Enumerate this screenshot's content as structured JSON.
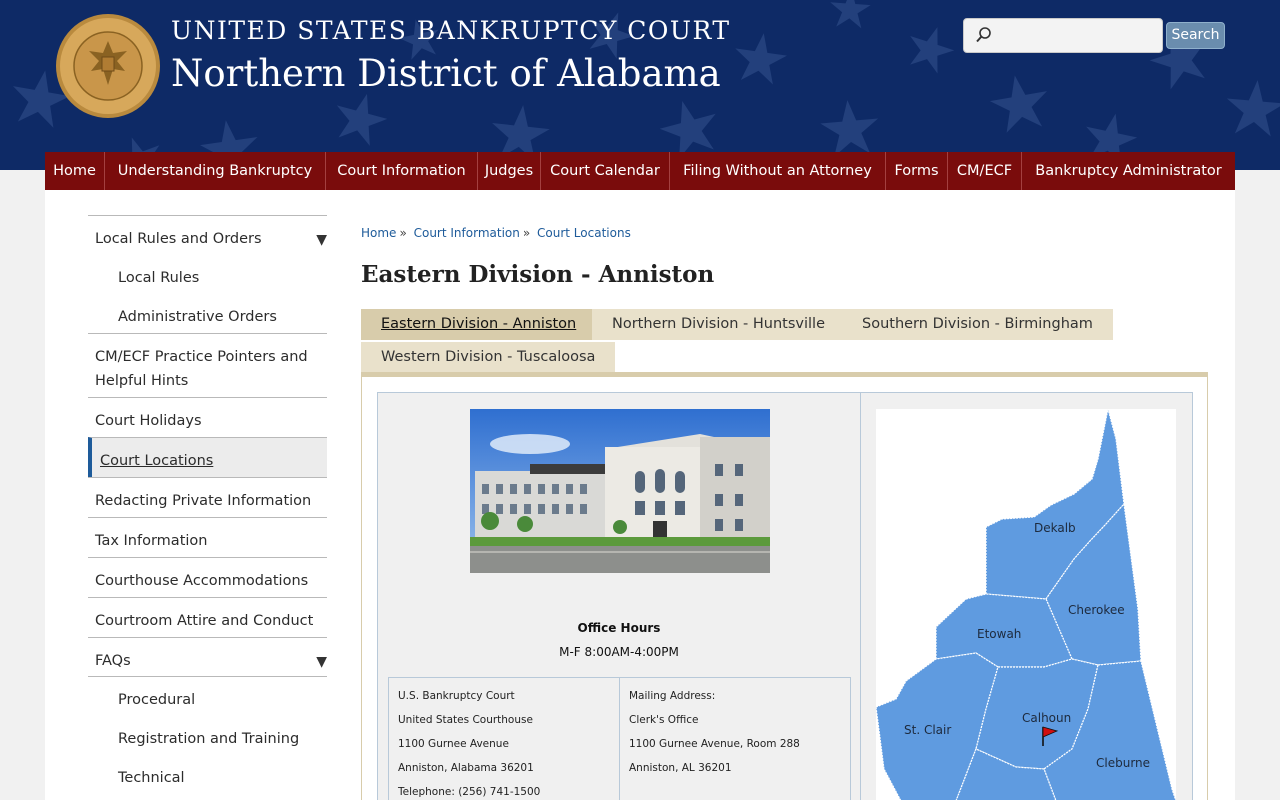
{
  "header": {
    "line1": "UNITED STATES BANKRUPTCY COURT",
    "line2": "Northern District of Alabama",
    "seal_text_top": "UNITED STATES BANKRUPTCY COURT",
    "seal_text_bottom": "NORTHERN DISTRICT OF ALABAMA",
    "search_placeholder": "",
    "search_value": "",
    "search_button": "Search",
    "colors": {
      "header_bg": "#0e2a66",
      "nav_bg": "#7a0c0c",
      "link": "#1e5b9a"
    }
  },
  "nav": [
    "Home",
    "Understanding Bankruptcy",
    "Court Information",
    "Judges",
    "Court Calendar",
    "Filing Without an Attorney",
    "Forms",
    "CM/ECF",
    "Bankruptcy Administrator"
  ],
  "sidebar": [
    {
      "label": "Local Rules and Orders",
      "expandable": true
    },
    {
      "label": "Local Rules",
      "sub": true
    },
    {
      "label": "Administrative Orders",
      "sub": true
    },
    {
      "label": "CM/ECF Practice Pointers and Helpful Hints"
    },
    {
      "label": "Court Holidays"
    },
    {
      "label": "Court Locations",
      "active": true
    },
    {
      "label": "Redacting Private Information"
    },
    {
      "label": "Tax Information"
    },
    {
      "label": "Courthouse Accommodations"
    },
    {
      "label": "Courtroom Attire and Conduct"
    },
    {
      "label": "FAQs",
      "expandable": true
    },
    {
      "label": "Procedural",
      "sub": true
    },
    {
      "label": "Registration and Training",
      "sub": true
    },
    {
      "label": "Technical",
      "sub": true
    }
  ],
  "breadcrumb": {
    "home": "Home",
    "section": "Court Information",
    "page": "Court Locations",
    "separator": "»"
  },
  "page_title": "Eastern Division - Anniston",
  "tabs": [
    "Eastern Division - Anniston",
    "Northern Division - Huntsville",
    "Southern Division - Birmingham",
    "Western Division - Tuscaloosa"
  ],
  "office": {
    "hours_title": "Office Hours",
    "hours": "M-F 8:00AM-4:00PM",
    "physical": [
      "U.S. Bankruptcy Court",
      "United States Courthouse",
      "1100 Gurnee Avenue",
      "Anniston, Alabama 36201",
      "Telephone: (256) 741-1500"
    ],
    "mailing": [
      "Mailing Address:",
      "Clerk's Office",
      "1100 Gurnee Avenue, Room 288",
      "Anniston, AL 36201"
    ]
  },
  "map": {
    "counties": [
      "Dekalb",
      "Cherokee",
      "Etowah",
      "St. Clair",
      "Calhoun",
      "Cleburne"
    ]
  }
}
